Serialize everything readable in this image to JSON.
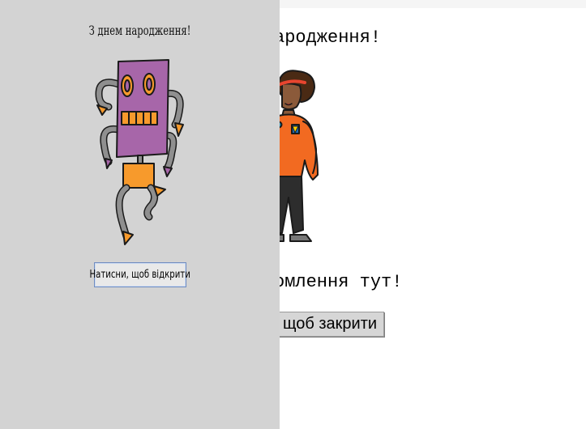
{
  "front": {
    "title": "З днем народження!",
    "open_button_label": "Натисни, щоб відкрити",
    "illustration": "robot"
  },
  "inside": {
    "title_visible": "ародження!",
    "message_visible": "омлення тут!",
    "close_button_visible": "щоб закрити",
    "illustration": "person"
  },
  "colors": {
    "cover_background": "#d3d3d3",
    "page_background": "#ffffff",
    "robot_body": "#a766a9",
    "robot_orange": "#f79a2c",
    "robot_limbs": "#8f8f8f",
    "person_shirt": "#f26a21",
    "person_pants": "#2d2d2d",
    "button_border": "#6f8cc0"
  }
}
